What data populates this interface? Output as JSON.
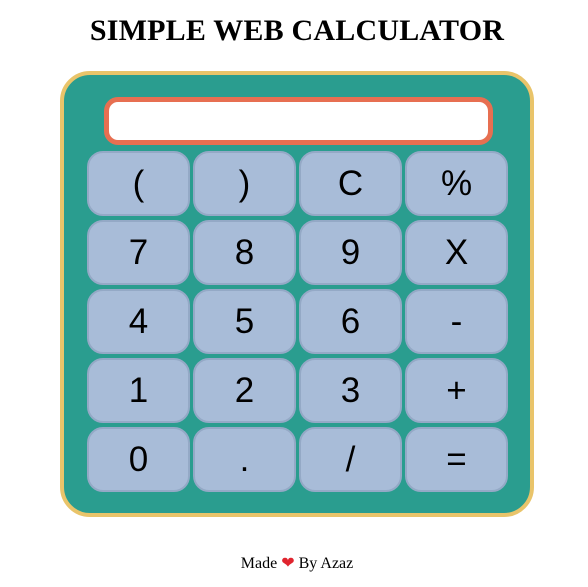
{
  "header": {
    "title": "SIMPLE WEB CALCULATOR"
  },
  "display": {
    "value": ""
  },
  "keys": [
    "(",
    ")",
    "C",
    "%",
    "7",
    "8",
    "9",
    "X",
    "4",
    "5",
    "6",
    "-",
    "1",
    "2",
    "3",
    "+",
    "0",
    ".",
    "/",
    "="
  ],
  "footer": {
    "prefix": "Made",
    "heart": "❤",
    "suffix": "By Azaz"
  },
  "colors": {
    "body_bg": "#2a9d8f",
    "body_border": "#e9c46a",
    "display_border": "#e76f51",
    "key_bg": "#a8bcd8",
    "heart": "#e0242e"
  }
}
